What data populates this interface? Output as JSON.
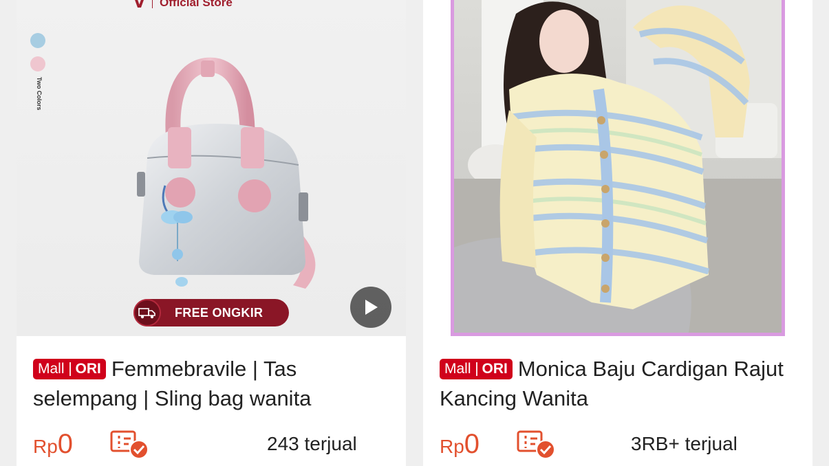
{
  "products": [
    {
      "store_label": "Official Store",
      "swatch_text": "Two Colors",
      "promo_badge": "FREE ONGKIR",
      "badge_left": "Mall",
      "badge_right": "ORI",
      "title": "Femmebravile | Tas selempang | Sling bag wanita",
      "currency": "Rp",
      "price": "0",
      "sold": "243 terjual"
    },
    {
      "badge_left": "Mall",
      "badge_right": "ORI",
      "title": "Monica Baju Cardigan Rajut Kancing Wanita",
      "currency": "Rp",
      "price": "0",
      "sold": "3RB+ terjual"
    }
  ],
  "colors": {
    "price": "#e2502e",
    "mall_badge": "#d0011b",
    "store_brand": "#a01f2e",
    "free_badge": "#8a1626",
    "frame_border": "#d99ae0"
  },
  "icons": [
    "play-icon",
    "truck-icon",
    "voucher-check-icon"
  ]
}
